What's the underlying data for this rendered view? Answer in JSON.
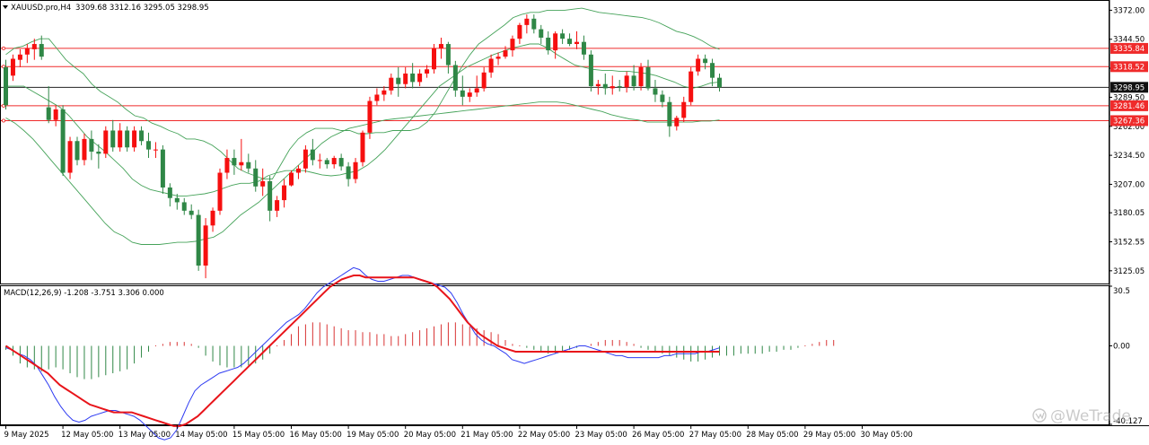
{
  "header": {
    "symbol_label": "XAUUSD.pro,H4",
    "ohlc_label": "3309.68 3312.16 3295.05 3298.95"
  },
  "macd_header": {
    "label": "MACD(12,26,9) -1.208 -3.751 3.306 0.000"
  },
  "watermark": {
    "text": "@WeTrade",
    "icon": "wetrade-logo-icon"
  },
  "colors": {
    "bull": "#f60f0f",
    "bear": "#2f8746",
    "bollinger": "#46a35a",
    "level_line": "#ef2b2b",
    "current_price_line": "#222222",
    "current_price_box": "#111111",
    "macd_line": "#2f3cf2",
    "signal_line": "#e8141a",
    "hist_pos": "#d83434",
    "hist_neg": "#2f8746"
  },
  "chart_data": [
    {
      "type": "candlestick",
      "title": "XAUUSD.pro,H4",
      "ylim": [
        3113,
        3380
      ],
      "price_ticks": [
        "3372.00",
        "3344.50",
        "3317.05",
        "3289.50",
        "3262.00",
        "3234.50",
        "3207.00",
        "3180.05",
        "3152.55",
        "3125.05"
      ],
      "price_tick_values": [
        3372.0,
        3344.5,
        3317.05,
        3289.5,
        3262.0,
        3234.5,
        3207.0,
        3180.05,
        3152.55,
        3125.05
      ],
      "time_labels": [
        "9 May 2025",
        "12 May 05:00",
        "13 May 05:00",
        "14 May 05:00",
        "15 May 05:00",
        "16 May 05:00",
        "19 May 05:00",
        "20 May 05:00",
        "21 May 05:00",
        "22 May 05:00",
        "23 May 05:00",
        "26 May 05:00",
        "27 May 05:00",
        "28 May 05:00",
        "29 May 05:00",
        "30 May 05:00"
      ],
      "time_label_candle_index": [
        0,
        8,
        16,
        24,
        32,
        40,
        48,
        56,
        64,
        72,
        80,
        88,
        96,
        104,
        112,
        120
      ],
      "horizontal_levels": [
        {
          "value": 3335.84,
          "label": "3335.84"
        },
        {
          "value": 3318.52,
          "label": "3318.52"
        },
        {
          "value": 3281.46,
          "label": "3281.46"
        },
        {
          "value": 3267.36,
          "label": "3267.36"
        }
      ],
      "current_price": {
        "value": 3298.95,
        "label": "3298.95"
      },
      "candles": [
        [
          3318,
          3325,
          3278,
          3282
        ],
        [
          3310,
          3330,
          3305,
          3326
        ],
        [
          3325,
          3335,
          3318,
          3330
        ],
        [
          3330,
          3340,
          3322,
          3336
        ],
        [
          3335,
          3345,
          3325,
          3340
        ],
        [
          3340,
          3348,
          3325,
          3328
        ],
        [
          3280,
          3300,
          3265,
          3268
        ],
        [
          3268,
          3282,
          3262,
          3278
        ],
        [
          3278,
          3282,
          3215,
          3218
        ],
        [
          3218,
          3252,
          3212,
          3248
        ],
        [
          3248,
          3252,
          3225,
          3230
        ],
        [
          3230,
          3255,
          3225,
          3250
        ],
        [
          3250,
          3258,
          3230,
          3238
        ],
        [
          3238,
          3245,
          3222,
          3236
        ],
        [
          3236,
          3262,
          3232,
          3258
        ],
        [
          3258,
          3268,
          3238,
          3242
        ],
        [
          3242,
          3265,
          3238,
          3258
        ],
        [
          3258,
          3262,
          3238,
          3242
        ],
        [
          3242,
          3262,
          3238,
          3258
        ],
        [
          3258,
          3262,
          3244,
          3248
        ],
        [
          3248,
          3256,
          3232,
          3240
        ],
        [
          3240,
          3247,
          3232,
          3240
        ],
        [
          3240,
          3244,
          3198,
          3204
        ],
        [
          3204,
          3208,
          3186,
          3194
        ],
        [
          3194,
          3198,
          3183,
          3190
        ],
        [
          3190,
          3194,
          3178,
          3182
        ],
        [
          3182,
          3188,
          3174,
          3178
        ],
        [
          3178,
          3183,
          3125,
          3130
        ],
        [
          3130,
          3175,
          3118,
          3168
        ],
        [
          3168,
          3185,
          3162,
          3182
        ],
        [
          3182,
          3222,
          3178,
          3218
        ],
        [
          3218,
          3240,
          3212,
          3232
        ],
        [
          3232,
          3240,
          3216,
          3225
        ],
        [
          3225,
          3250,
          3220,
          3228
        ],
        [
          3228,
          3236,
          3218,
          3222
        ],
        [
          3222,
          3230,
          3200,
          3205
        ],
        [
          3205,
          3222,
          3196,
          3210
        ],
        [
          3210,
          3215,
          3172,
          3182
        ],
        [
          3182,
          3196,
          3176,
          3192
        ],
        [
          3192,
          3212,
          3185,
          3206
        ],
        [
          3206,
          3220,
          3205,
          3218
        ],
        [
          3218,
          3225,
          3212,
          3222
        ],
        [
          3222,
          3244,
          3218,
          3240
        ],
        [
          3240,
          3250,
          3225,
          3230
        ],
        [
          3230,
          3236,
          3222,
          3230
        ],
        [
          3230,
          3232,
          3222,
          3226
        ],
        [
          3226,
          3234,
          3222,
          3232
        ],
        [
          3232,
          3236,
          3220,
          3224
        ],
        [
          3224,
          3228,
          3205,
          3212
        ],
        [
          3212,
          3232,
          3208,
          3228
        ],
        [
          3228,
          3258,
          3224,
          3256
        ],
        [
          3256,
          3290,
          3250,
          3286
        ],
        [
          3286,
          3298,
          3282,
          3292
        ],
        [
          3292,
          3300,
          3286,
          3296
        ],
        [
          3296,
          3312,
          3292,
          3308
        ],
        [
          3308,
          3318,
          3290,
          3302
        ],
        [
          3302,
          3318,
          3298,
          3312
        ],
        [
          3312,
          3322,
          3298,
          3304
        ],
        [
          3304,
          3316,
          3300,
          3312
        ],
        [
          3312,
          3320,
          3308,
          3316
        ],
        [
          3316,
          3340,
          3312,
          3336
        ],
        [
          3336,
          3346,
          3326,
          3340
        ],
        [
          3340,
          3342,
          3312,
          3320
        ],
        [
          3320,
          3324,
          3290,
          3296
        ],
        [
          3296,
          3310,
          3282,
          3290
        ],
        [
          3290,
          3298,
          3285,
          3294
        ],
        [
          3294,
          3310,
          3290,
          3298
        ],
        [
          3298,
          3318,
          3295,
          3313
        ],
        [
          3313,
          3330,
          3308,
          3326
        ],
        [
          3326,
          3332,
          3320,
          3328
        ],
        [
          3328,
          3338,
          3326,
          3334
        ],
        [
          3334,
          3348,
          3328,
          3345
        ],
        [
          3345,
          3360,
          3340,
          3358
        ],
        [
          3358,
          3368,
          3350,
          3364
        ],
        [
          3364,
          3368,
          3350,
          3354
        ],
        [
          3354,
          3358,
          3340,
          3346
        ],
        [
          3346,
          3352,
          3330,
          3334
        ],
        [
          3334,
          3352,
          3326,
          3350
        ],
        [
          3350,
          3354,
          3340,
          3345
        ],
        [
          3345,
          3350,
          3338,
          3340
        ],
        [
          3340,
          3352,
          3335,
          3342
        ],
        [
          3342,
          3348,
          3325,
          3330
        ],
        [
          3330,
          3334,
          3295,
          3300
        ],
        [
          3300,
          3306,
          3292,
          3302
        ],
        [
          3302,
          3312,
          3292,
          3298
        ],
        [
          3298,
          3310,
          3292,
          3300
        ],
        [
          3300,
          3306,
          3295,
          3299
        ],
        [
          3299,
          3314,
          3294,
          3310
        ],
        [
          3310,
          3320,
          3296,
          3300
        ],
        [
          3300,
          3322,
          3296,
          3318
        ],
        [
          3318,
          3325,
          3296,
          3298
        ],
        [
          3298,
          3306,
          3285,
          3292
        ],
        [
          3292,
          3296,
          3280,
          3285
        ],
        [
          3285,
          3290,
          3252,
          3262
        ],
        [
          3262,
          3272,
          3258,
          3270
        ],
        [
          3270,
          3290,
          3266,
          3285
        ],
        [
          3285,
          3318,
          3282,
          3314
        ],
        [
          3314,
          3330,
          3310,
          3326
        ],
        [
          3326,
          3330,
          3316,
          3322
        ],
        [
          3322,
          3326,
          3300,
          3308
        ],
        [
          3308,
          3312,
          3295,
          3299
        ]
      ],
      "bollinger": {
        "upper": [
          3330,
          3336,
          3338,
          3342,
          3345,
          3345,
          3335,
          3325,
          3318,
          3312,
          3302,
          3295,
          3290,
          3285,
          3278,
          3272,
          3270,
          3265,
          3262,
          3258,
          3255,
          3250,
          3250,
          3248,
          3244,
          3238,
          3230,
          3222,
          3218,
          3215,
          3212,
          3212,
          3226,
          3240,
          3250,
          3256,
          3260,
          3260,
          3260,
          3258,
          3258,
          3255,
          3255,
          3256,
          3256,
          3258,
          3258,
          3258,
          3260,
          3266,
          3276,
          3290,
          3304,
          3318,
          3330,
          3340,
          3346,
          3352,
          3358,
          3365,
          3368,
          3370,
          3370,
          3372,
          3372,
          3372,
          3373,
          3374,
          3372,
          3370,
          3369,
          3368,
          3367,
          3366,
          3365,
          3363,
          3360,
          3356,
          3352,
          3350,
          3347,
          3343,
          3338,
          3335
        ],
        "middle": [
          3300,
          3300,
          3300,
          3295,
          3290,
          3285,
          3280,
          3272,
          3262,
          3252,
          3245,
          3238,
          3230,
          3222,
          3212,
          3206,
          3202,
          3200,
          3198,
          3196,
          3196,
          3197,
          3198,
          3200,
          3203,
          3206,
          3208,
          3208,
          3210,
          3215,
          3218,
          3220,
          3220,
          3220,
          3218,
          3216,
          3215,
          3216,
          3218,
          3220,
          3225,
          3232,
          3240,
          3250,
          3260,
          3270,
          3280,
          3290,
          3300,
          3306,
          3312,
          3318,
          3322,
          3326,
          3330,
          3333,
          3336,
          3338,
          3340,
          3340,
          3336,
          3330,
          3325,
          3320,
          3318,
          3316,
          3315,
          3315,
          3314,
          3314,
          3313,
          3312,
          3310,
          3307,
          3304,
          3300,
          3298,
          3300,
          3303,
          3304
        ],
        "lower": [
          3270,
          3265,
          3258,
          3250,
          3240,
          3230,
          3220,
          3210,
          3200,
          3190,
          3180,
          3170,
          3162,
          3158,
          3152,
          3150,
          3150,
          3150,
          3151,
          3152,
          3152,
          3153,
          3155,
          3157,
          3162,
          3170,
          3178,
          3184,
          3190,
          3198,
          3206,
          3214,
          3222,
          3230,
          3238,
          3246,
          3252,
          3256,
          3260,
          3262,
          3264,
          3266,
          3268,
          3269,
          3270,
          3271,
          3272,
          3273,
          3274,
          3275,
          3276,
          3277,
          3278,
          3279,
          3280,
          3281,
          3282,
          3283,
          3284,
          3285,
          3285,
          3285,
          3284,
          3282,
          3280,
          3278,
          3276,
          3273,
          3271,
          3269,
          3268,
          3266,
          3266,
          3266,
          3266,
          3266,
          3266,
          3267,
          3267,
          3268
        ]
      }
    },
    {
      "type": "bar",
      "title": "MACD(12,26,9) -1.208 -3.751 3.306 0.000",
      "ylim": [
        -40.127,
        30.5
      ],
      "y_ticks": [
        "30.5",
        "0.00",
        "-40.127"
      ],
      "y_tick_values": [
        30.5,
        0,
        -40.127
      ],
      "histogram": [
        -2,
        -5,
        -9,
        -11,
        -12,
        -13,
        -12,
        -11,
        -12,
        -14,
        -16,
        -17,
        -17,
        -16,
        -15,
        -14,
        -13,
        -12,
        -9,
        -6,
        -3,
        0,
        1,
        2,
        2,
        2,
        1,
        -1,
        -5,
        -8,
        -10,
        -11,
        -11,
        -11,
        -10,
        -9,
        -7,
        -4,
        0,
        3,
        6,
        10,
        11,
        12,
        12,
        11,
        10,
        9,
        8,
        8,
        7,
        7,
        6,
        6,
        5,
        5,
        6,
        7,
        8,
        9,
        10,
        11,
        12,
        12,
        11,
        10,
        9,
        8,
        7,
        6,
        3,
        1,
        0,
        -1,
        -2,
        -3,
        -4,
        -4,
        -3,
        -2,
        -1,
        0,
        1,
        2,
        3,
        3,
        3,
        2,
        1,
        -1,
        -2,
        -3,
        -4,
        -5,
        -6,
        -7,
        -8,
        -8,
        -7,
        -6,
        -5,
        -5,
        -5,
        -4,
        -4,
        -4,
        -4,
        -3,
        -3,
        -2,
        -2,
        -1,
        0,
        1,
        2,
        3,
        3
      ],
      "macd": [
        -1,
        -2,
        -4,
        -5,
        -7,
        -10,
        -15,
        -20,
        -26,
        -31,
        -35,
        -38,
        -39,
        -38,
        -36,
        -35,
        -34,
        -33,
        -33,
        -34,
        -35,
        -36,
        -38,
        -41,
        -44,
        -47,
        -48,
        -47,
        -43,
        -36,
        -29,
        -23,
        -20,
        -18,
        -16,
        -14,
        -13,
        -12,
        -11,
        -9,
        -6,
        -3,
        0,
        3,
        6,
        9,
        12,
        14,
        16,
        19,
        23,
        27,
        30,
        32,
        34,
        36,
        38,
        40,
        39,
        36,
        34,
        33,
        33,
        34,
        35,
        36,
        36,
        35,
        34,
        33,
        32,
        31,
        30,
        27,
        22,
        16,
        11,
        6,
        3,
        1,
        0,
        -2,
        -4,
        -7,
        -8,
        -9,
        -8,
        -7,
        -6,
        -5,
        -4,
        -3,
        -2,
        -1,
        0,
        0,
        -1,
        -2,
        -3,
        -4,
        -5,
        -5,
        -6,
        -6,
        -6,
        -6,
        -6,
        -6,
        -5,
        -5,
        -4,
        -4,
        -4,
        -4,
        -3,
        -3,
        -2,
        -1
      ],
      "signal": [
        0,
        -2,
        -4,
        -6,
        -8,
        -10,
        -12,
        -14,
        -17,
        -20,
        -22,
        -24,
        -26,
        -28,
        -30,
        -31,
        -32,
        -33,
        -34,
        -34,
        -34,
        -34,
        -35,
        -36,
        -37,
        -38,
        -39,
        -40,
        -41,
        -41,
        -40,
        -38,
        -36,
        -33,
        -30,
        -27,
        -24,
        -21,
        -18,
        -15,
        -12,
        -9,
        -6,
        -3,
        0,
        3,
        6,
        9,
        12,
        15,
        18,
        21,
        24,
        27,
        30,
        32,
        34,
        35,
        36,
        36,
        35,
        35,
        35,
        35,
        35,
        35,
        35,
        35,
        35,
        34,
        33,
        32,
        30,
        27,
        24,
        20,
        16,
        12,
        9,
        6,
        4,
        2,
        0,
        -1,
        -2,
        -3,
        -3,
        -3,
        -3,
        -3,
        -3,
        -3,
        -3,
        -3,
        -3,
        -3,
        -3,
        -3,
        -3,
        -3,
        -3,
        -3,
        -3,
        -3,
        -3,
        -3,
        -3,
        -3,
        -3,
        -3,
        -3,
        -3,
        -3,
        -3,
        -3,
        -3,
        -3,
        -3,
        -3,
        -3
      ]
    }
  ]
}
